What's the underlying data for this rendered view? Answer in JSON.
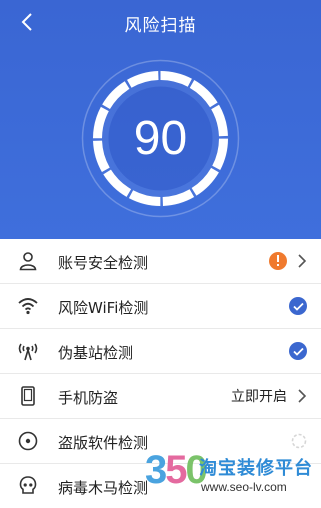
{
  "header": {
    "title": "风险扫描",
    "back_icon": "chevron-left-icon"
  },
  "scan": {
    "score": "90"
  },
  "items": [
    {
      "label": "账号安全检测",
      "icon": "user-icon",
      "status": "warning",
      "action_label": ""
    },
    {
      "label": "风险WiFi检测",
      "icon": "wifi-icon",
      "status": "ok",
      "action_label": ""
    },
    {
      "label": "伪基站检测",
      "icon": "antenna-icon",
      "status": "ok",
      "action_label": ""
    },
    {
      "label": "手机防盗",
      "icon": "phone-icon",
      "status": "action",
      "action_label": "立即开启"
    },
    {
      "label": "盗版软件检测",
      "icon": "disc-icon",
      "status": "scanning",
      "action_label": ""
    },
    {
      "label": "病毒木马检测",
      "icon": "skull-icon",
      "status": "pending",
      "action_label": ""
    }
  ],
  "watermark": {
    "number_chars": [
      "3",
      "5",
      "0"
    ],
    "brand": "淘宝装修平台",
    "url": "www.seo-lv.com"
  },
  "colors": {
    "header_blue": "#3a66d3",
    "check_blue": "#3b67cf",
    "warning_orange": "#f07a2e"
  }
}
